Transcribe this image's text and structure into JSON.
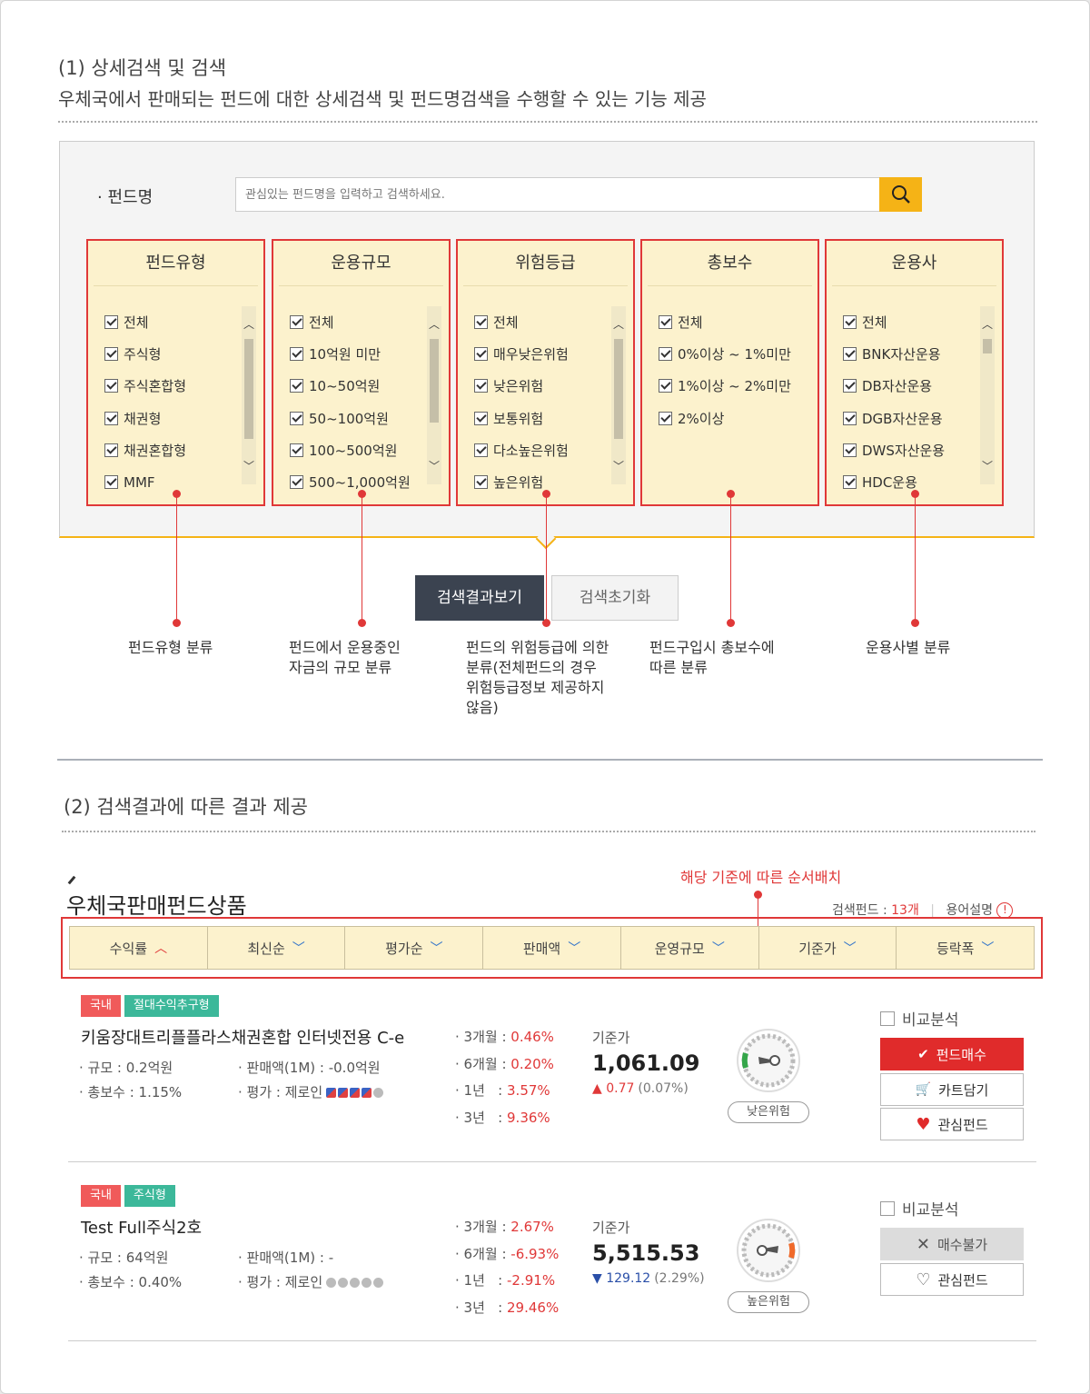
{
  "section1": {
    "title": "(1) 상세검색 및 검색",
    "desc": "우체국에서 판매되는 펀드에 대한 상세검색 및 펀드명검색을 수행할 수 있는 기능 제공"
  },
  "search": {
    "label": "· 펀드명",
    "placeholder": "관심있는 펀드명을 입력하고 검색하세요."
  },
  "filters": [
    {
      "title": "펀드유형",
      "items": [
        "전체",
        "주식형",
        "주식혼합형",
        "채권형",
        "채권혼합형",
        "MMF"
      ],
      "scroll": true
    },
    {
      "title": "운용규모",
      "items": [
        "전체",
        "10억원 미만",
        "10~50억원",
        "50~100억원",
        "100~500억원",
        "500~1,000억원"
      ],
      "scroll": true
    },
    {
      "title": "위험등급",
      "items": [
        "전체",
        "매우낮은위험",
        "낮은위험",
        "보통위험",
        "다소높은위험",
        "높은위험"
      ],
      "scroll": true
    },
    {
      "title": "총보수",
      "items": [
        "전체",
        "0%이상 ~ 1%미만",
        "1%이상 ~ 2%미만",
        "2%이상"
      ],
      "scroll": false
    },
    {
      "title": "운용사",
      "items": [
        "전체",
        "BNK자산운용",
        "DB자산운용",
        "DGB자산운용",
        "DWS자산운용",
        "HDC운용"
      ],
      "scroll": true
    }
  ],
  "buttons": {
    "view_results": "검색결과보기",
    "reset": "검색초기화"
  },
  "captions": [
    "펀드유형 분류",
    "펀드에서 운용중인\n자금의 규모 분류",
    "펀드의 위험등급에 의한\n분류(전체펀드의 경우\n위험등급정보 제공하지\n않음)",
    "펀드구입시 총보수에\n따른 분류",
    "운용사별 분류"
  ],
  "section2": {
    "title": "(2) 검색결과에 따른 결과 제공",
    "order_note": "해당 기준에 따른 순서배치",
    "product_title": "우체국판매펀드상품",
    "count_label": "검색펀드 : ",
    "count_value": "13개",
    "glossary": "용어설명",
    "info_icon": "!"
  },
  "sort_tabs": [
    {
      "label": "수익률",
      "dir": "up"
    },
    {
      "label": "최신순",
      "dir": "down"
    },
    {
      "label": "평가순",
      "dir": "down"
    },
    {
      "label": "판매액",
      "dir": "down"
    },
    {
      "label": "운영규모",
      "dir": "down"
    },
    {
      "label": "기준가",
      "dir": "down"
    },
    {
      "label": "등락폭",
      "dir": "down"
    }
  ],
  "funds": [
    {
      "tags": [
        "국내",
        "절대수익추구형"
      ],
      "name": "키움장대트리플플라스채권혼합 인터넷전용 C-e",
      "size": "· 규모 : 0.2억원",
      "fee": "· 총보수 : 1.15%",
      "sales": "· 판매액(1M) : -0.0억원",
      "rating": "· 평가 : 제로인",
      "rating_stars": 4,
      "returns": [
        {
          "label": "· 3개월 : ",
          "value": "0.46%"
        },
        {
          "label": "· 6개월 : ",
          "value": "0.20%"
        },
        {
          "label": "· 1년   : ",
          "value": "3.57%"
        },
        {
          "label": "· 3년   : ",
          "value": "9.36%"
        }
      ],
      "nav_label": "기준가",
      "nav_value": "1,061.09",
      "change": "▲ 0.77",
      "change_pct": "(0.07%)",
      "risk": "낮은위험",
      "compare": "비교분석",
      "btn1": "펀드매수",
      "btn2": "카트담기",
      "btn3": "관심펀드"
    },
    {
      "tags": [
        "국내",
        "주식형"
      ],
      "name": "Test Full주식2호",
      "size": "· 규모 : 64억원",
      "fee": "· 총보수 : 0.40%",
      "sales": "· 판매액(1M) : -",
      "rating": "· 평가 : 제로인",
      "rating_stars": 0,
      "returns": [
        {
          "label": "· 3개월 : ",
          "value": "2.67%"
        },
        {
          "label": "· 6개월 : ",
          "value": "-6.93%"
        },
        {
          "label": "· 1년   : ",
          "value": "-2.91%"
        },
        {
          "label": "· 3년   : ",
          "value": "29.46%"
        }
      ],
      "nav_label": "기준가",
      "nav_value": "5,515.53",
      "change": "▼ 129.12",
      "change_pct": "(2.29%)",
      "risk": "높은위험",
      "compare": "비교분석",
      "btn1": "매수불가",
      "btn3": "관심펀드"
    }
  ],
  "colors": {
    "accent_red": "#e03838",
    "highlight_yellow": "#fcf2cd",
    "search_button": "#f5b316",
    "dark_button": "#3b4350",
    "tag_red": "#f05a5a",
    "tag_green": "#3cb89a"
  }
}
